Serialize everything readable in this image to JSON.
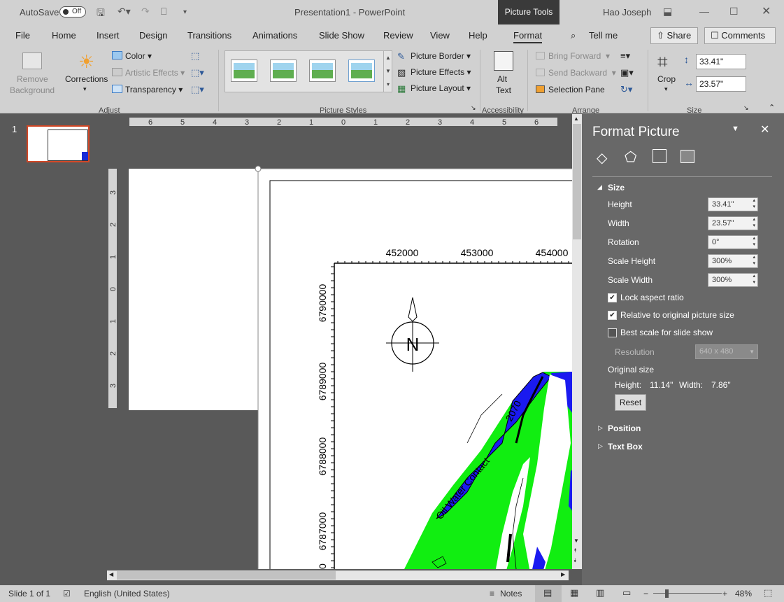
{
  "titlebar": {
    "autosave_label": "AutoSave",
    "autosave_state": "Off",
    "document_title": "Presentation1 - PowerPoint",
    "context_tab": "Picture Tools",
    "user_name": "Hao Joseph"
  },
  "menu": [
    "File",
    "Home",
    "Insert",
    "Design",
    "Transitions",
    "Animations",
    "Slide Show",
    "Review",
    "View",
    "Help",
    "Format"
  ],
  "tell_me": "Tell me",
  "share_label": "Share",
  "comments_label": "Comments",
  "ribbon": {
    "remove_background": [
      "Remove",
      "Background"
    ],
    "corrections": "Corrections",
    "color": "Color",
    "artistic_effects": "Artistic Effects",
    "transparency": "Transparency",
    "adjust_group": "Adjust",
    "picture_border": "Picture Border",
    "picture_effects": "Picture Effects",
    "picture_layout": "Picture Layout",
    "picture_styles_group": "Picture Styles",
    "alt_text": [
      "Alt",
      "Text"
    ],
    "accessibility_group": "Accessibility",
    "bring_forward": "Bring Forward",
    "send_backward": "Send Backward",
    "selection_pane": "Selection Pane",
    "arrange_group": "Arrange",
    "crop": "Crop",
    "height_value": "33.41\"",
    "width_value": "23.57\"",
    "size_group": "Size"
  },
  "slide_number": "1",
  "ruler_top": [
    "6",
    "5",
    "4",
    "3",
    "2",
    "1",
    "0",
    "1",
    "2",
    "3",
    "4",
    "5",
    "6"
  ],
  "ruler_left": [
    "3",
    "2",
    "1",
    "0",
    "1",
    "2",
    "3"
  ],
  "map": {
    "x_ticks": [
      "452000",
      "453000",
      "454000"
    ],
    "y_ticks": [
      "6790000",
      "6789000",
      "6788000",
      "6787000"
    ],
    "y_tick_partial": "0",
    "north_letter": "N",
    "contour_label": "2070",
    "contact_label": "Oil Water Contact"
  },
  "panel": {
    "title": "Format Picture",
    "size_section": "Size",
    "height_label": "Height",
    "height_value": "33.41\"",
    "width_label": "Width",
    "width_value": "23.57\"",
    "rotation_label": "Rotation",
    "rotation_value": "0°",
    "scale_height_label": "Scale Height",
    "scale_height_value": "300%",
    "scale_width_label": "Scale Width",
    "scale_width_value": "300%",
    "lock_aspect": "Lock aspect ratio",
    "relative_original": "Relative to original picture size",
    "best_scale": "Best scale for slide show",
    "resolution_label": "Resolution",
    "resolution_value": "640 x 480",
    "original_size_label": "Original size",
    "orig_height_label": "Height:",
    "orig_height_value": "11.14\"",
    "orig_width_label": "Width:",
    "orig_width_value": "7.86\"",
    "reset_label": "Reset",
    "position_section": "Position",
    "textbox_section": "Text Box"
  },
  "status": {
    "slide_info": "Slide 1 of 1",
    "language": "English (United States)",
    "notes": "Notes",
    "zoom": "48%"
  }
}
